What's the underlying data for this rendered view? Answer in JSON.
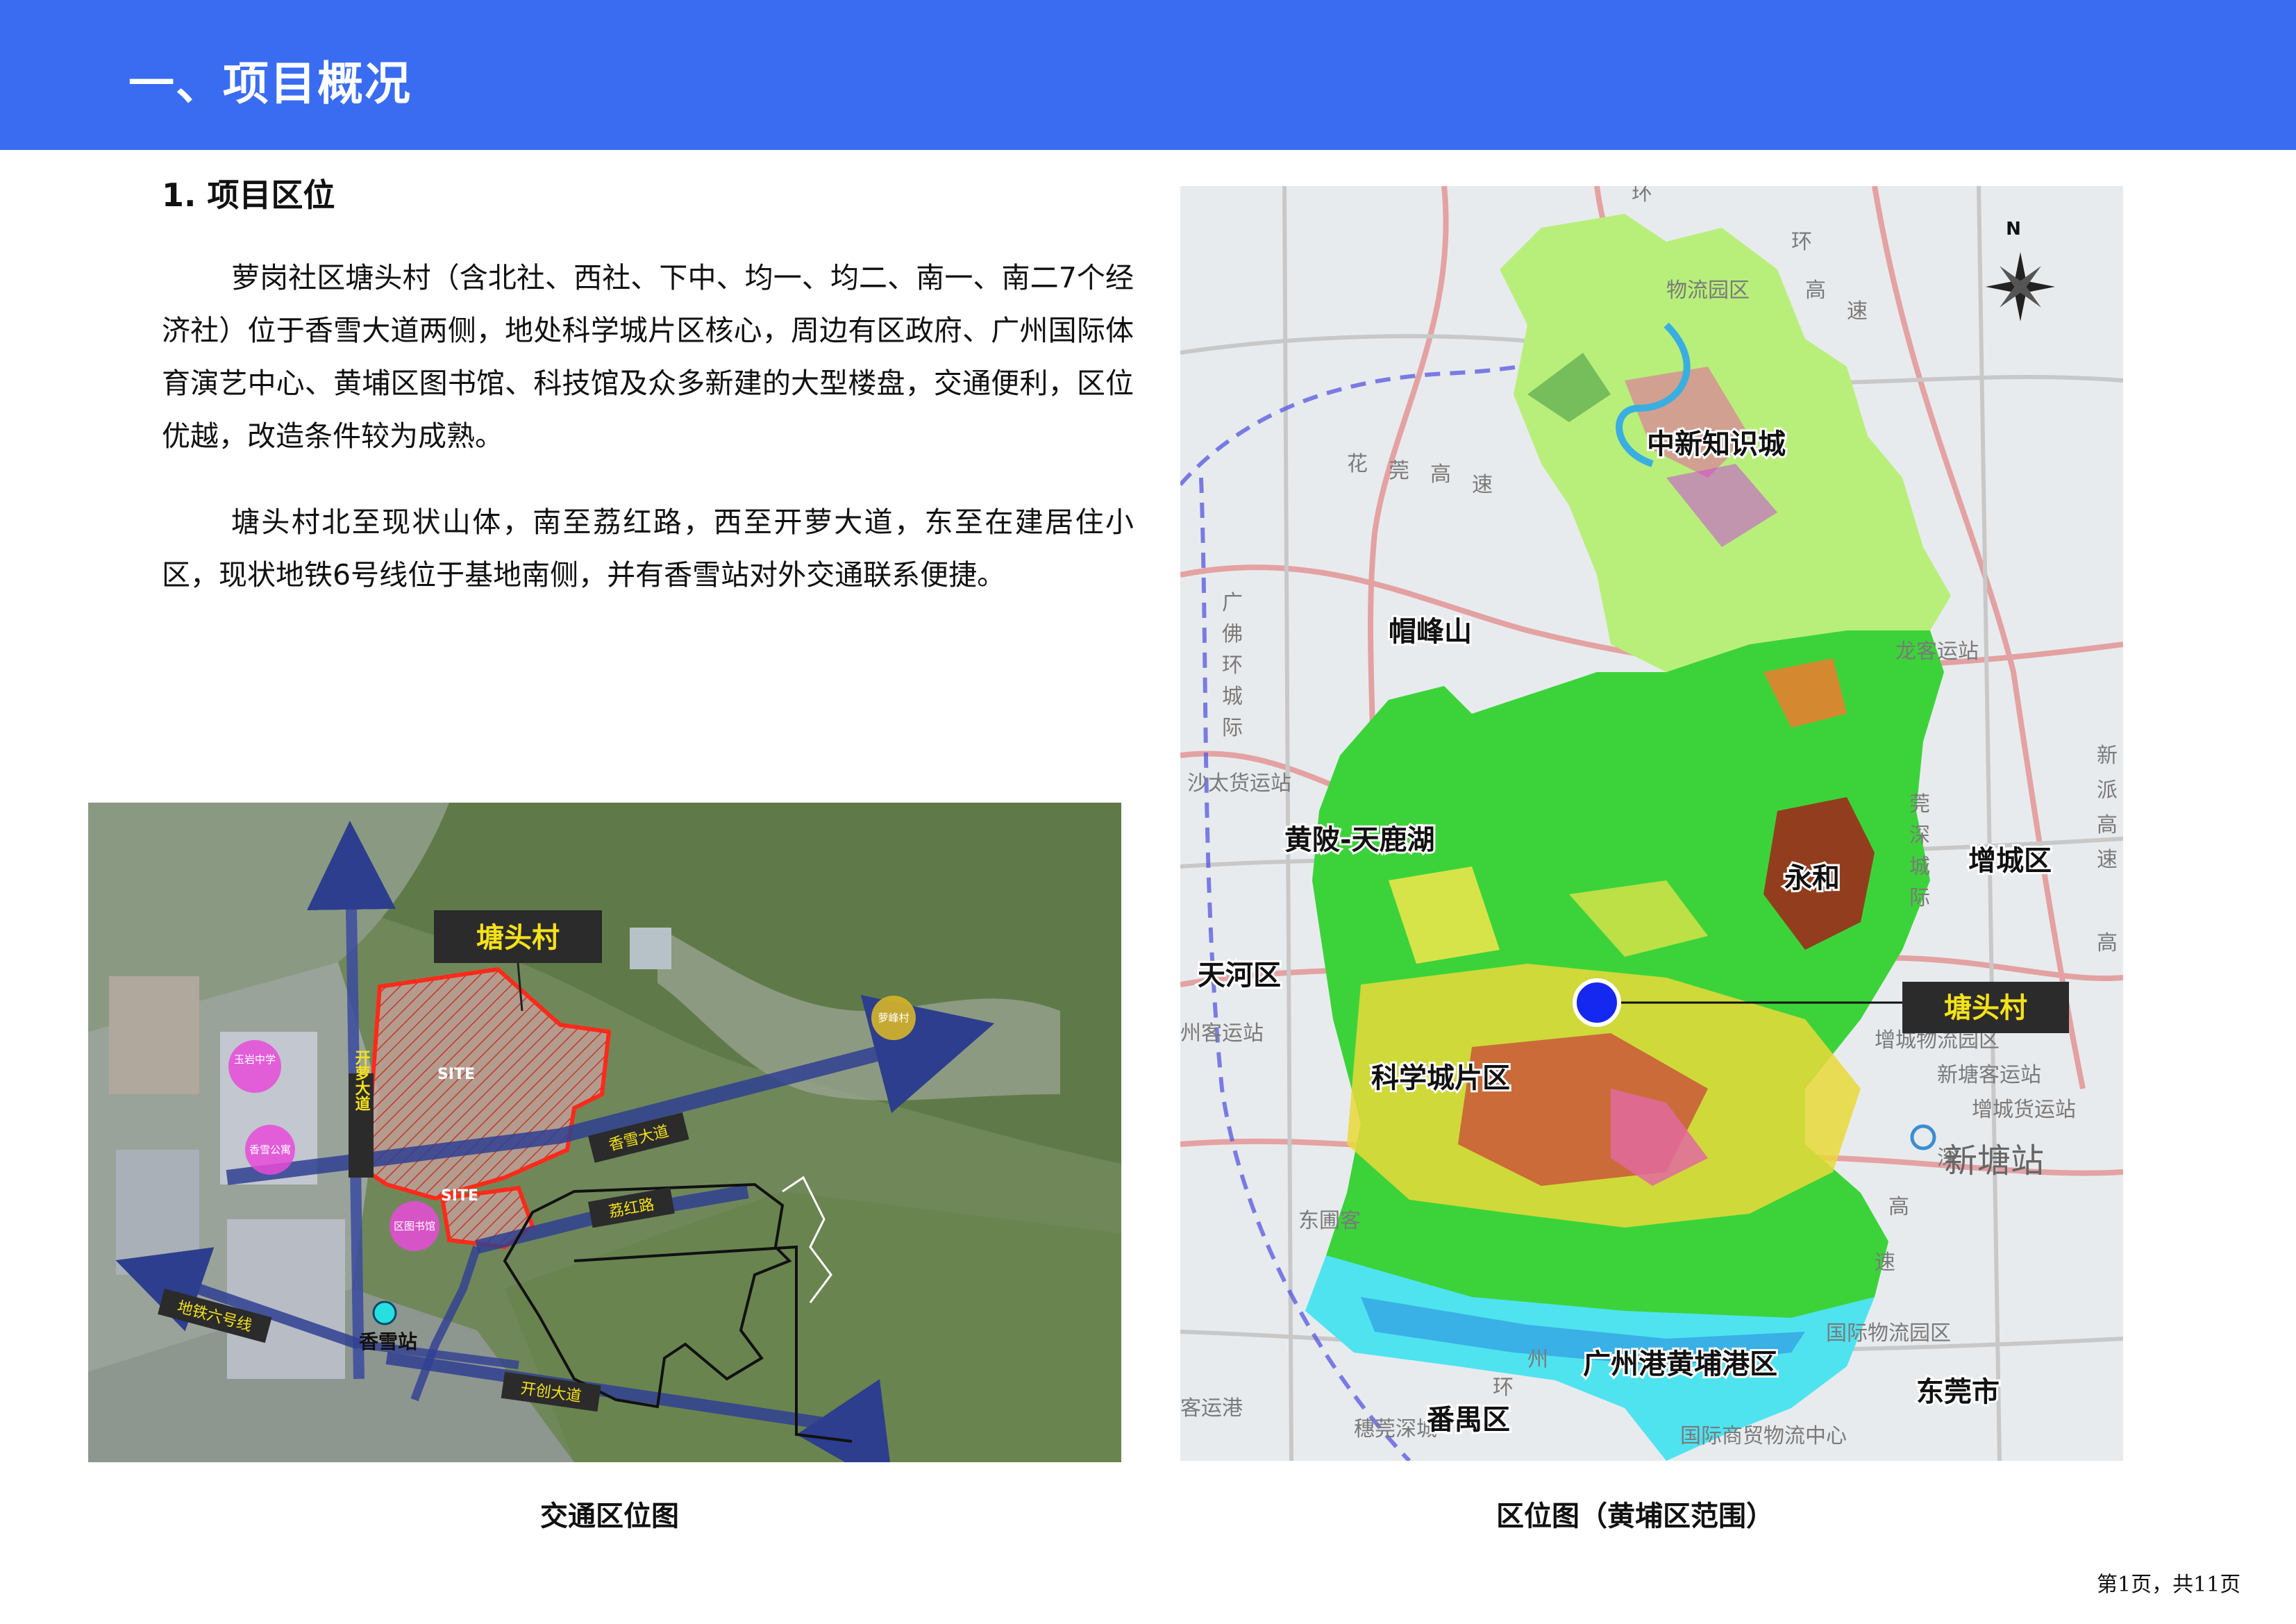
{
  "header": {
    "title": "一、项目概况"
  },
  "section": {
    "title": "1. 项目区位"
  },
  "paragraphs": {
    "p1": "萝岗社区塘头村（含北社、西社、下中、均一、均二、南一、南二7个经济社）位于香雪大道两侧，地处科学城片区核心，周边有区政府、广州国际体育演艺中心、黄埔区图书馆、科技馆及众多新建的大型楼盘，交通便利，区位优越，改造条件较为成熟。",
    "p2": "塘头村北至现状山体，南至荔红路，西至开萝大道，东至在建居住小区，现状地铁6号线位于基地南侧，并有香雪站对外交通联系便捷。"
  },
  "left_map": {
    "caption": "交通区位图",
    "village_label": "塘头村",
    "site_label_1": "SITE",
    "site_label_2": "SITE",
    "road_kailuo": "开萝大道",
    "road_xiangxue": "香雪大道",
    "road_lihong": "荔红路",
    "road_kaichuang": "开创大道",
    "metro_line": "地铁六号线",
    "station": "香雪站",
    "poi_yuyan": "玉岩中学",
    "poi_xiangxue": "香雪公寓",
    "poi_library": "区图书馆",
    "poi_luofeng": "萝峰村"
  },
  "right_map": {
    "caption": "区位图（黄埔区范围）",
    "north_arrow": "N",
    "label_zhongxin": "中新知识城",
    "label_maofeng": "帽峰山",
    "label_huangpi": "黄陂-天鹿湖",
    "label_yonghe": "永和",
    "label_zengcheng": "增城区",
    "label_tianhe": "天河区",
    "label_kexuecheng": "科学城片区",
    "label_village": "塘头村",
    "label_xintang": "新塘站",
    "label_gangqu": "广州港黄埔港区",
    "label_panyu": "番禺区",
    "label_dongguan": "东莞市",
    "bg_huan1": "环",
    "bg_huan2": "环",
    "bg_gao": "高",
    "bg_su": "速",
    "bg_wuliu": "物流园区",
    "bg_hua": "花",
    "bg_guan": "莞",
    "bg_gao2": "高",
    "bg_su2": "速",
    "bg_guang": "广",
    "bg_fo": "佛",
    "bg_huan3": "环",
    "bg_cheng": "城",
    "bg_ji": "际",
    "bg_longgui": "龙客运站",
    "bg_shatai": "沙太货运站",
    "bg_guan2": "莞",
    "bg_shen": "深",
    "bg_cheng2": "城",
    "bg_ji2": "际",
    "bg_xin": "新",
    "bg_pai": "派",
    "bg_gao3": "高",
    "bg_su3": "速",
    "bg_gao4": "高",
    "bg_keyun": "州客运站",
    "bg_chengwuliu": "增城物流园区",
    "bg_xintangkeyun": "新塘客运站",
    "bg_zengchenghuo": "增城货运站",
    "bg_shen2": "深",
    "bg_gao5": "高",
    "bg_su4": "速",
    "bg_dongpu": "东圃客",
    "bg_guoji": "国际物流园区",
    "bg_huan4": "环",
    "bg_guozhou": "州",
    "bg_suigang": "穗莞深城",
    "bg_shangmao": "国际商贸物流中心",
    "bg_keyungang": "客运港"
  },
  "footer": {
    "page": "第1页，共11页"
  },
  "colors": {
    "header_blue": "#3a6cf2",
    "village_red": "#e0302a",
    "label_yellow": "#f5e21a",
    "green": "#3cd33a",
    "light_green": "#b8ef7a",
    "marker_blue": "#1428f0"
  }
}
